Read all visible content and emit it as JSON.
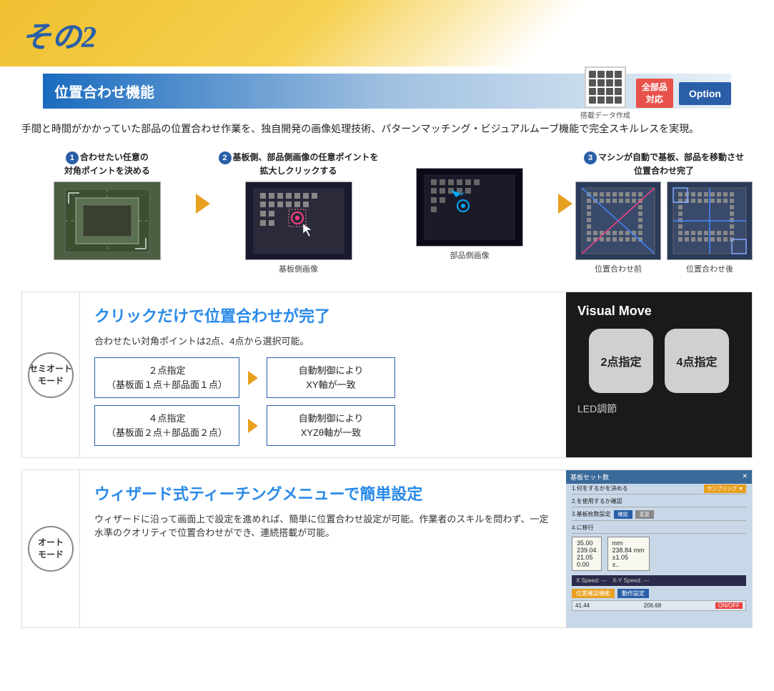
{
  "header": {
    "title": "その2"
  },
  "section": {
    "title": "位置合わせ機能",
    "badge_all_line1": "全部品",
    "badge_all_line2": "対応",
    "badge_option": "Option",
    "badge_sub": "搭載データ作成"
  },
  "intro": {
    "text": "手間と時間がかかっていた部品の位置合わせ作業を、独自開発の画像処理技術、パターンマッチング・ビジュアルムーブ機能で完全スキルレスを実現。"
  },
  "steps": [
    {
      "num": "1",
      "label_line1": "合わせたい任意の",
      "label_line2": "対角ポイントを決める",
      "caption": ""
    },
    {
      "num": "2",
      "label_line1": "基板側、部品側画像の任意ポイントを",
      "label_line2": "拡大しクリックする",
      "caption": "基板側画像"
    },
    {
      "caption2": "部品側画像"
    },
    {
      "num": "3",
      "label_line1": "マシンが自動で基板、部品を移動させ",
      "label_line2": "位置合わせ完了",
      "caption_before": "位置合わせ前",
      "caption_after": "位置合わせ後"
    }
  ],
  "semi_auto": {
    "mode_label": "セミオート\nモード",
    "title": "クリックだけで位置合わせが完了",
    "desc": "合わせたい対角ポイントは2点、4点から選択可能。",
    "flow": [
      {
        "input": "２点指定\n（基板面１点＋部品面１点）",
        "output": "自動制御により\nXY軸が一致"
      },
      {
        "input": "４点指定\n（基板面２点＋部品面２点）",
        "output": "自動制御により\nXYZθ軸が一致"
      }
    ],
    "visual_move_title": "Visual Move",
    "btn_2pt": "2点指定",
    "btn_4pt": "4点指定",
    "led_label": "LED調節"
  },
  "auto": {
    "mode_label": "オート\nモード",
    "title": "ウィザード式ティーチングメニューで簡単設定",
    "desc": "ウィザードに沿って画面上で設定を進めれば、簡単に位置合わせ設定が可能。作業者のスキルを問わず、一定水準のクオリティで位置合わせができ、連続搭載が可能。"
  }
}
